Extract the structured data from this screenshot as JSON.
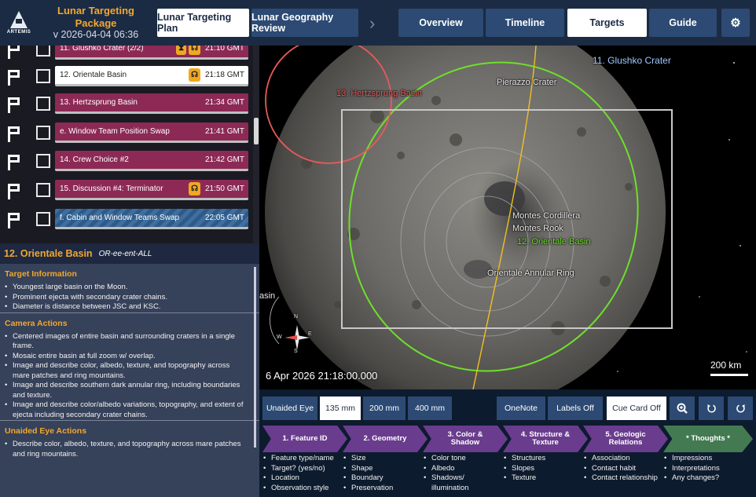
{
  "header": {
    "logo_text": "ARTEMIS",
    "package_title": "Lunar Targeting Package",
    "package_version": "v 2026-04-04 06:36",
    "nav": {
      "plan": "Lunar Targeting Plan",
      "geography": "Lunar Geography Review",
      "overview": "Overview",
      "timeline": "Timeline",
      "targets": "Targets",
      "guide": "Guide"
    },
    "chevron": "›",
    "settings_glyph": "⚙"
  },
  "targets": [
    {
      "name": "11. Glushko Crater (2/2)",
      "time": "21:10 GMT",
      "style": "magenta",
      "badges": [
        "⧗",
        "☊"
      ]
    },
    {
      "name": "12. Orientale Basin",
      "time": "21:18 GMT",
      "style": "white",
      "badges": [
        "☊"
      ]
    },
    {
      "name": "13. Hertzsprung Basin",
      "time": "21:34 GMT",
      "style": "magenta",
      "badges": []
    },
    {
      "name": "e. Window Team Position Swap",
      "time": "21:41 GMT",
      "style": "magenta",
      "badges": []
    },
    {
      "name": "14. Crew Choice #2",
      "time": "21:42 GMT",
      "style": "magenta",
      "badges": []
    },
    {
      "name": "15. Discussion #4: Terminator",
      "time": "21:50 GMT",
      "style": "magenta",
      "badges": [
        "☊"
      ]
    },
    {
      "name": "f. Cabin and Window Teams Swap",
      "time": "22:05 GMT",
      "style": "blue",
      "badges": []
    }
  ],
  "details": {
    "title": "12.  Orientale Basin",
    "pronunciation": "OR-ee-ent-ALL",
    "sections": [
      {
        "heading": "Target Information",
        "items": [
          "Youngest large basin on the Moon.",
          "Prominent ejecta with secondary crater chains.",
          "Diameter is distance between JSC and KSC."
        ]
      },
      {
        "heading": "Camera Actions",
        "items": [
          "Centered images of entire basin and surrounding craters in a single frame.",
          "Mosaic entire basin at full zoom w/ overlap.",
          "Image and describe color, albedo, texture, and topography across mare patches and ring mountains.",
          "Image and describe southern dark annular ring, including boundaries and texture.",
          "Image and describe color/albedo variations, topography, and extent of ejecta including secondary crater chains."
        ]
      },
      {
        "heading": "Unaided Eye Actions",
        "items": [
          "Describe color, albedo, texture, and topography across mare patches and ring mountains."
        ]
      }
    ]
  },
  "map": {
    "labels": {
      "glushko": "11. Glushko Crater",
      "hertzsprung": "13. Hertzsprung Basin",
      "pierazzo": "Pierazzo Crater",
      "cordillera": "Montes Cordillera",
      "rook": "Montes Rook",
      "orientale": "12. Orientale Basin",
      "annular": "Orientale Annular Ring",
      "basin_partial": "asin"
    },
    "compass": {
      "n": "N",
      "e": "E",
      "s": "S",
      "w": "W"
    },
    "timestamp": "6 Apr 2026 21:18:00.000",
    "scale_label": "200 km",
    "colors": {
      "orientale": "#6ee02a",
      "hertzsprung": "#e85a5a",
      "terminator": "#f0c020",
      "frame": "#c8c8c8"
    }
  },
  "toolbar": {
    "unaided_eye": "Unaided Eye",
    "mm135": "135 mm",
    "mm200": "200 mm",
    "mm400": "400 mm",
    "onenote": "OneNote",
    "labels": "Labels Off",
    "cue_card": "Cue Card Off",
    "zoom_icon": "search-plus-icon",
    "rotate_ccw_icon": "rotate-ccw-icon",
    "rotate_cw_icon": "rotate-cw-icon"
  },
  "steps": [
    {
      "label": "1. Feature ID",
      "items": [
        "Feature type/name",
        "Target? (yes/no)",
        "Location",
        "Observation style"
      ]
    },
    {
      "label": "2. Geometry",
      "items": [
        "Size",
        "Shape",
        "Boundary",
        "Preservation"
      ]
    },
    {
      "label": "3. Color & Shadow",
      "items": [
        "Color tone",
        "Albedo",
        "Shadows/ illumination"
      ]
    },
    {
      "label": "4. Structure & Texture",
      "items": [
        "Structures",
        "Slopes",
        "Texture"
      ]
    },
    {
      "label": "5. Geologic Relations",
      "items": [
        "Association",
        "Contact habit",
        "Contact relationship"
      ]
    },
    {
      "label": "* Thoughts *",
      "items": [
        "Impressions",
        "Interpretations",
        "Any changes?"
      ]
    }
  ]
}
